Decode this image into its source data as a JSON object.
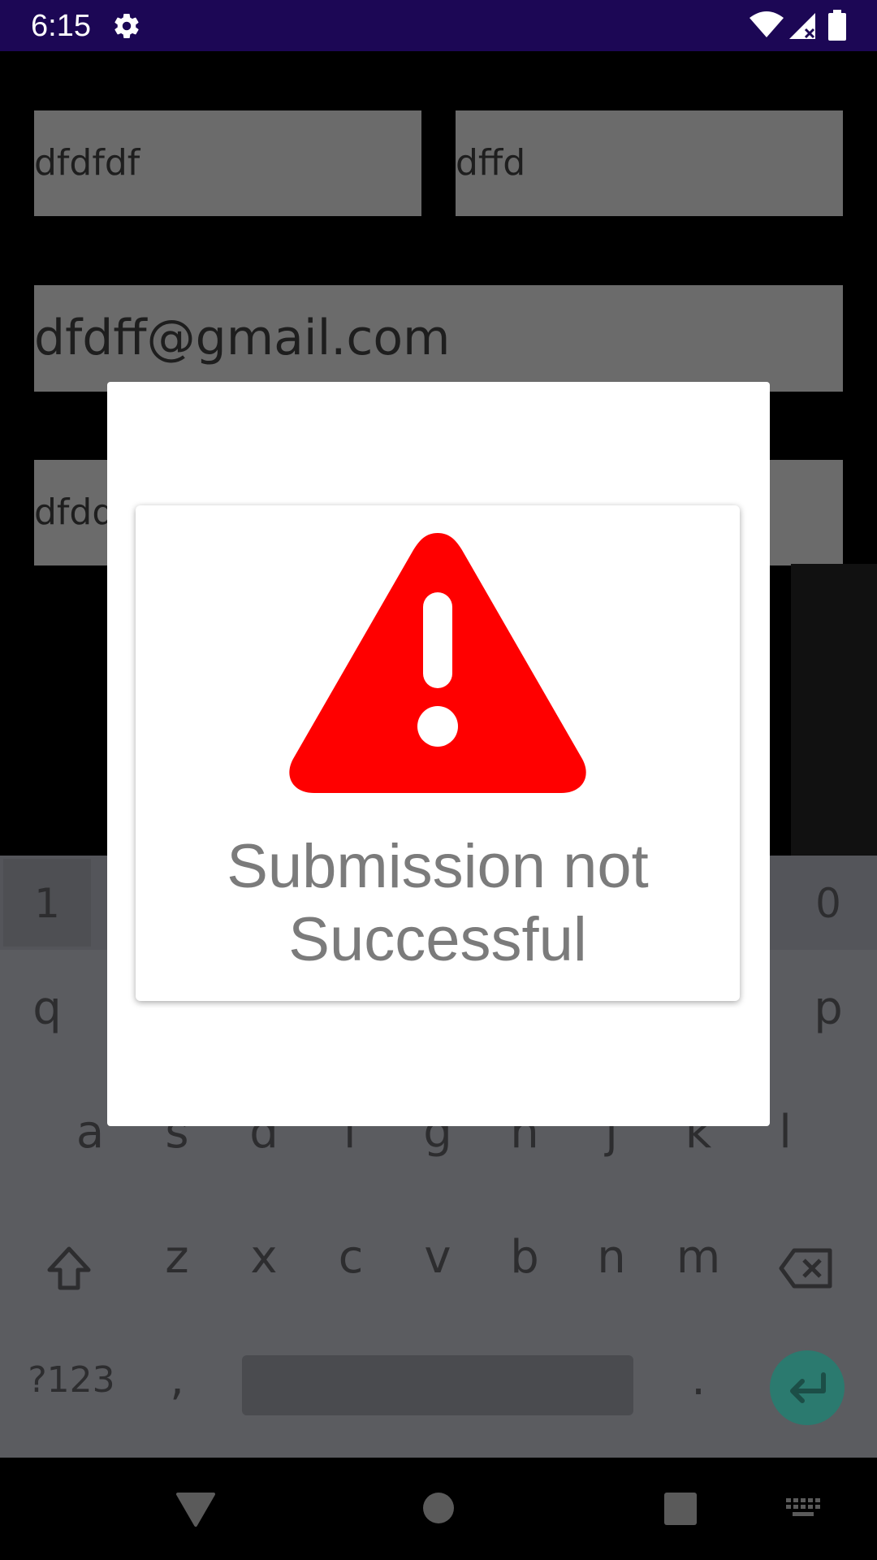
{
  "status_bar": {
    "time": "6:15",
    "icons": [
      "gear-icon",
      "wifi-icon",
      "signal-icon",
      "battery-icon"
    ]
  },
  "form": {
    "first_name_value": "dfdfdf",
    "last_name_value": "dffd",
    "email_value": "dfdff@gmail.com",
    "fourth_field_value": "dfdd"
  },
  "keyboard": {
    "number_row": [
      "1",
      "0"
    ],
    "row1": [
      "q",
      "p"
    ],
    "row2": [
      "a",
      "s",
      "d",
      "f",
      "g",
      "h",
      "j",
      "k",
      "l"
    ],
    "row3": [
      "z",
      "x",
      "c",
      "v",
      "b",
      "n",
      "m"
    ],
    "symbols_key": "?123",
    "comma_key": ",",
    "period_key": "."
  },
  "dialog": {
    "message": "Submission not Successful",
    "icon": "warning-icon",
    "icon_color": "#ff0000"
  },
  "colors": {
    "status_bar": "#1c0755",
    "enter_key": "#2b7a6f"
  }
}
